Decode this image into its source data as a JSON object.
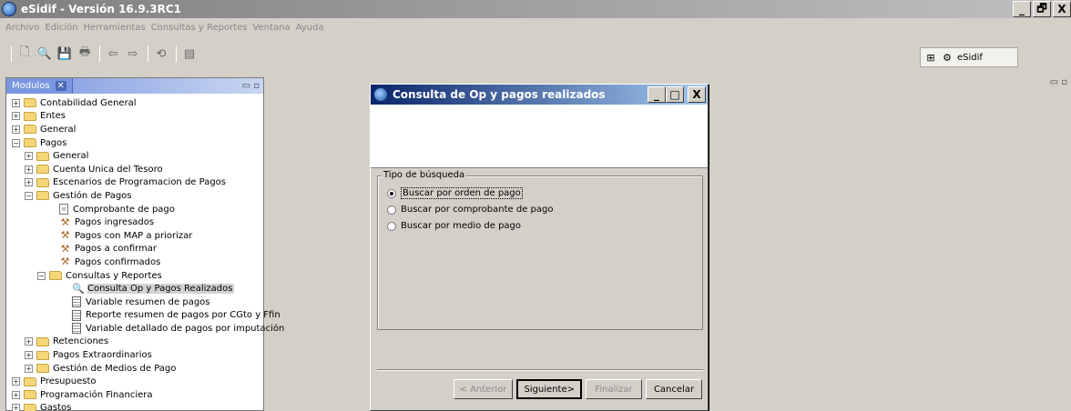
{
  "window": {
    "title": "eSidif - Versión 16.9.3RC1",
    "buttons": [
      "_",
      "🗗",
      "X"
    ]
  },
  "menu": [
    "Archivo",
    "Edición",
    "Herramientas",
    "Consultas y Reportes",
    "Ventana",
    "Ayuda"
  ],
  "toolbar": {
    "perspective_label": "eSidif"
  },
  "modules_panel": {
    "tab_label": "Modulos",
    "tab_close": "✕",
    "min_max": "▭ ▫"
  },
  "tree": [
    {
      "label": "Contabilidad General",
      "type": "folder",
      "depth": 0,
      "expander": "+"
    },
    {
      "label": "Entes",
      "type": "folder",
      "depth": 0,
      "expander": "+"
    },
    {
      "label": "General",
      "type": "folder",
      "depth": 0,
      "expander": "+"
    },
    {
      "label": "Pagos",
      "type": "folder",
      "depth": 0,
      "expander": "−"
    },
    {
      "label": "General",
      "type": "folder",
      "depth": 1,
      "expander": "+"
    },
    {
      "label": "Cuenta Unica del Tesoro",
      "type": "folder",
      "depth": 1,
      "expander": "+"
    },
    {
      "label": "Escenarios de Programacion de Pagos",
      "type": "folder",
      "depth": 1,
      "expander": "+"
    },
    {
      "label": "Gestión de Pagos",
      "type": "folder",
      "depth": 1,
      "expander": "−"
    },
    {
      "label": "Comprobante de pago",
      "type": "doc",
      "depth": 2
    },
    {
      "label": "Pagos ingresados",
      "type": "tool",
      "depth": 2
    },
    {
      "label": "Pagos con MAP a priorizar",
      "type": "tool",
      "depth": 2
    },
    {
      "label": "Pagos a confirmar",
      "type": "tool",
      "depth": 2
    },
    {
      "label": "Pagos confirmados",
      "type": "tool",
      "depth": 2
    },
    {
      "label": "Consultas y Reportes",
      "type": "folder",
      "depth": 2,
      "expander": "−"
    },
    {
      "label": "Consulta Op y Pagos Realizados",
      "type": "search",
      "depth": 3,
      "selected": true
    },
    {
      "label": "Variable resumen de pagos",
      "type": "calc",
      "depth": 3
    },
    {
      "label": "Reporte resumen de pagos por CGto y Ffin",
      "type": "calc",
      "depth": 3
    },
    {
      "label": "Variable detallado de pagos por imputación",
      "type": "calc",
      "depth": 3
    },
    {
      "label": "Retenciones",
      "type": "folder",
      "depth": 1,
      "expander": "+"
    },
    {
      "label": "Pagos Extraordinarios",
      "type": "folder",
      "depth": 1,
      "expander": "+"
    },
    {
      "label": "Gestión de Medios de Pago",
      "type": "folder",
      "depth": 1,
      "expander": "+"
    },
    {
      "label": "Presupuesto",
      "type": "folder",
      "depth": 0,
      "expander": "+"
    },
    {
      "label": "Programación Financiera",
      "type": "folder",
      "depth": 0,
      "expander": "+"
    },
    {
      "label": "Gastos",
      "type": "folder",
      "depth": 0,
      "expander": "+"
    }
  ],
  "dialog": {
    "title": "Consulta de Op y pagos realizados",
    "group_label": "Tipo de búsqueda",
    "options": [
      {
        "label": "Buscar por orden de pago",
        "checked": true
      },
      {
        "label": "Buscar por comprobante de pago",
        "checked": false
      },
      {
        "label": "Buscar por medio de pago",
        "checked": false
      }
    ],
    "buttons": {
      "back": "< Anterior",
      "next": "Siguiente>",
      "finish": "Finalizar",
      "cancel": "Cancelar"
    }
  }
}
